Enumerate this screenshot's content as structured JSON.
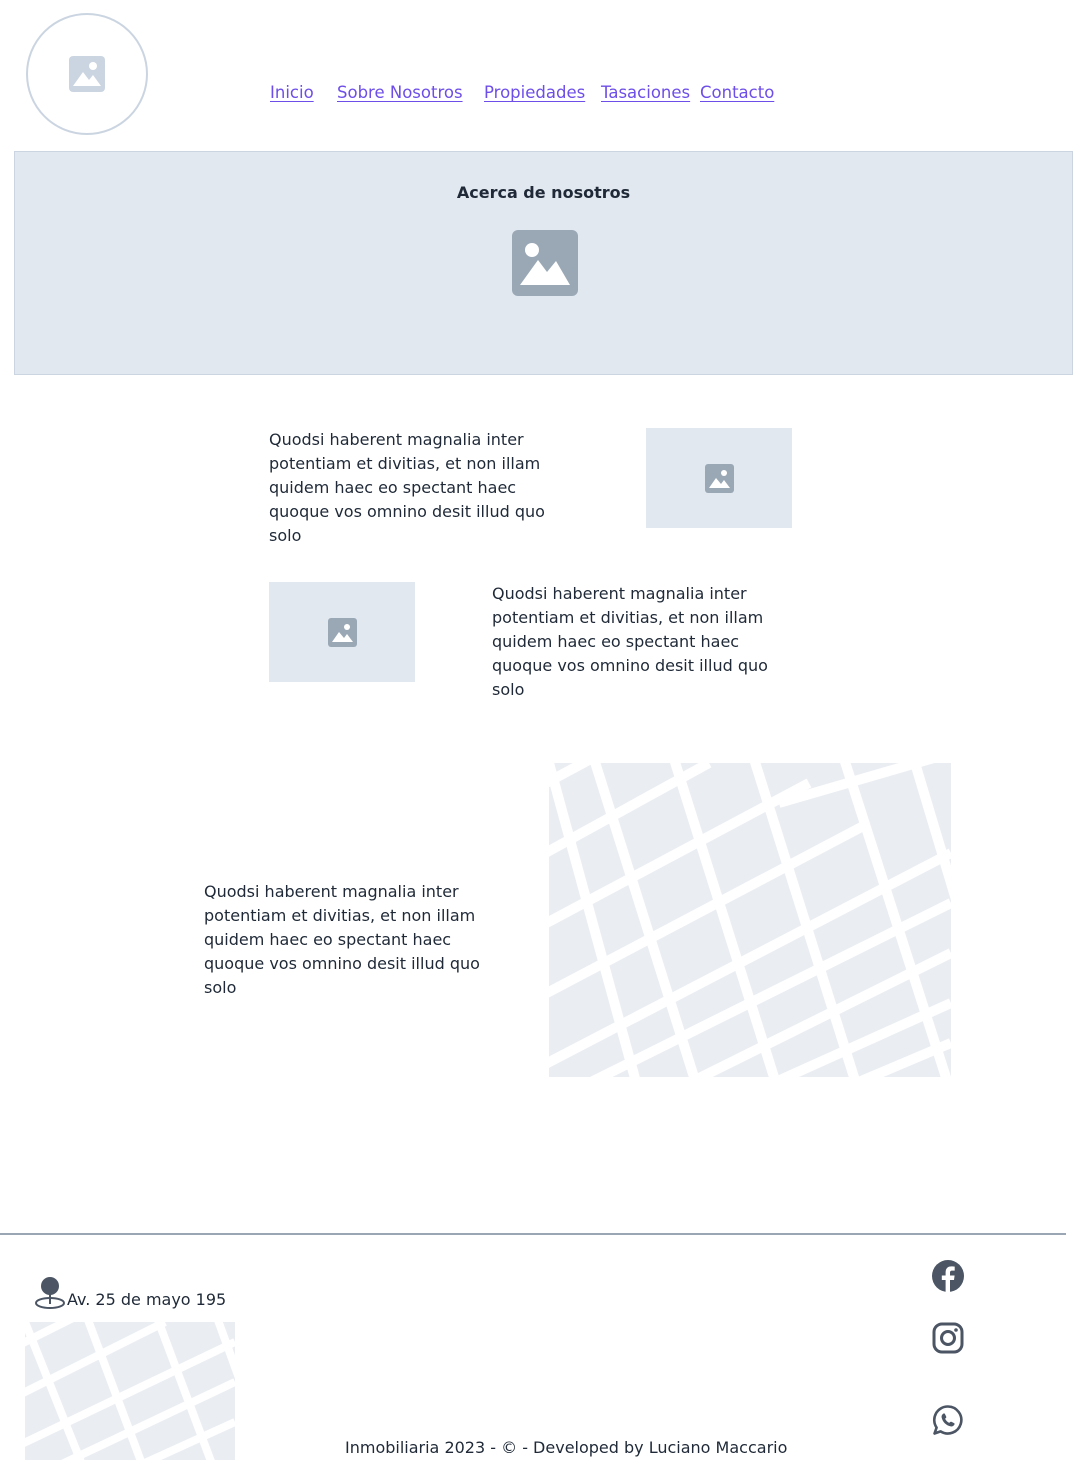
{
  "header": {
    "logo_icon": "image-placeholder-icon",
    "nav": [
      {
        "label": "Inicio"
      },
      {
        "label": "Sobre Nosotros"
      },
      {
        "label": "Propiedades"
      },
      {
        "label": "Tasaciones"
      },
      {
        "label": "Contacto"
      }
    ],
    "link_color": "#6d4ee8"
  },
  "hero": {
    "title": "Acerca de nosotros",
    "image_icon": "image-placeholder-icon",
    "background": "#e2e8f0"
  },
  "sections": [
    {
      "text": "Quodsi haberent magnalia inter potentiam et divitias, et non illam quidem haec eo spectant haec quoque vos omnino desit illud quo solo"
    },
    {
      "text": "Quodsi haberent magnalia inter potentiam et divitias, et non illam quidem haec eo spectant haec quoque vos omnino desit illud quo solo"
    },
    {
      "text": "Quodsi haberent magnalia inter potentiam et divitias, et non illam quidem haec eo spectant haec quoque vos omnino desit illud quo solo"
    }
  ],
  "footer": {
    "address": "Av. 25 de mayo 195",
    "address_icon": "map-pin-icon",
    "copyright": "Inmobiliaria 2023 - © - Developed by Luciano Maccario",
    "social": [
      {
        "icon": "facebook-icon"
      },
      {
        "icon": "instagram-icon"
      },
      {
        "icon": "whatsapp-icon"
      }
    ]
  }
}
